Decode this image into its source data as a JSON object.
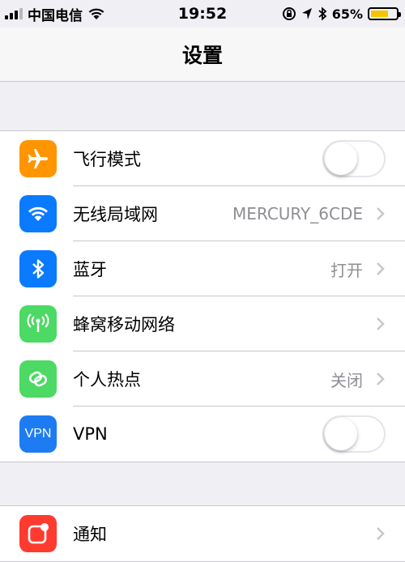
{
  "status_bar": {
    "carrier": "中国电信",
    "time": "19:52",
    "battery_percent": "65%",
    "signal_bars_filled": 3,
    "battery_level": 0.65
  },
  "nav": {
    "title": "设置"
  },
  "settings": {
    "airplane": {
      "label": "飞行模式",
      "icon": "airplane-icon",
      "color": "#ff9500",
      "on": false
    },
    "wifi": {
      "label": "无线局域网",
      "value": "MERCURY_6CDE",
      "icon": "wifi-icon",
      "color": "#0a7aff"
    },
    "bluetooth": {
      "label": "蓝牙",
      "value": "打开",
      "icon": "bluetooth-icon",
      "color": "#0a7aff"
    },
    "cellular": {
      "label": "蜂窝移动网络",
      "icon": "cellular-antenna-icon",
      "color": "#4cd964"
    },
    "hotspot": {
      "label": "个人热点",
      "value": "关闭",
      "icon": "hotspot-link-icon",
      "color": "#4cd964"
    },
    "vpn": {
      "label": "VPN",
      "icon_text": "VPN",
      "color": "#1e7cf2",
      "on": false
    },
    "notifications": {
      "label": "通知",
      "icon": "notification-icon",
      "color": "#ff3b30"
    }
  }
}
